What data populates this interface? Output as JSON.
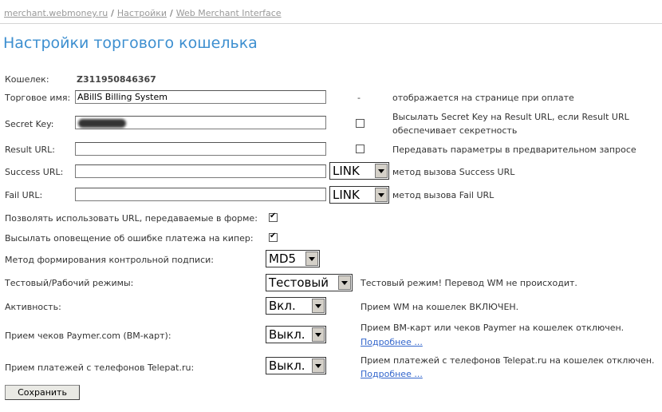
{
  "breadcrumb": {
    "items": [
      "merchant.webmoney.ru",
      "Настройки",
      "Web Merchant Interface"
    ],
    "sep": "/"
  },
  "page_title": "Настройки торгового кошелька",
  "wallet": {
    "label": "Кошелек:",
    "value": "Z311950846367"
  },
  "merchant_name": {
    "label": "Торговое имя:",
    "value": "ABillS Billing System",
    "marker": "-",
    "hint": "отображается на странице при оплате"
  },
  "secret_key": {
    "label": "Secret Key:",
    "hint_line1": "Высылать Secret Key на Result URL, если Result URL",
    "hint_line2": "обеспечивает секретность",
    "checked": false
  },
  "result_url": {
    "label": "Result URL:",
    "value": "",
    "hint": "Передавать параметры в предварительном запросе",
    "checked": false
  },
  "success_url": {
    "label": "Success URL:",
    "value": "",
    "method": "LINK",
    "hint": "метод вызова Success URL"
  },
  "fail_url": {
    "label": "Fail URL:",
    "value": "",
    "method": "LINK",
    "hint": "метод вызова Fail URL"
  },
  "allow_form_urls": {
    "label": "Позволять использовать URL, передаваемые в форме:",
    "checked": true
  },
  "error_notify": {
    "label": "Высылать оповещение об ошибке платежа на кипер:",
    "checked": true
  },
  "signature_method": {
    "label": "Метод формирования контрольной подписи:",
    "value": "MD5"
  },
  "mode": {
    "label": "Тестовый/Рабочий режимы:",
    "value": "Тестовый",
    "hint": "Тестовый режим! Перевод WM не происходит."
  },
  "activity": {
    "label": "Активность:",
    "value": "Вкл.",
    "hint": "Прием WM на кошелек ВКЛЮЧЕН."
  },
  "paymer": {
    "label": "Прием чеков Paymer.com (ВМ-карт):",
    "value": "Выкл.",
    "hint": "Прием ВМ-карт или чеков Paymer на кошелек отключен.",
    "more": "Подробнее ..."
  },
  "telepat": {
    "label": "Прием платежей с телефонов Telepat.ru:",
    "value": "Выкл.",
    "hint": "Прием платежей с телефонов Telepat.ru на кошелек отключен.",
    "more": "Подробнее ..."
  },
  "save_button": "Сохранить"
}
